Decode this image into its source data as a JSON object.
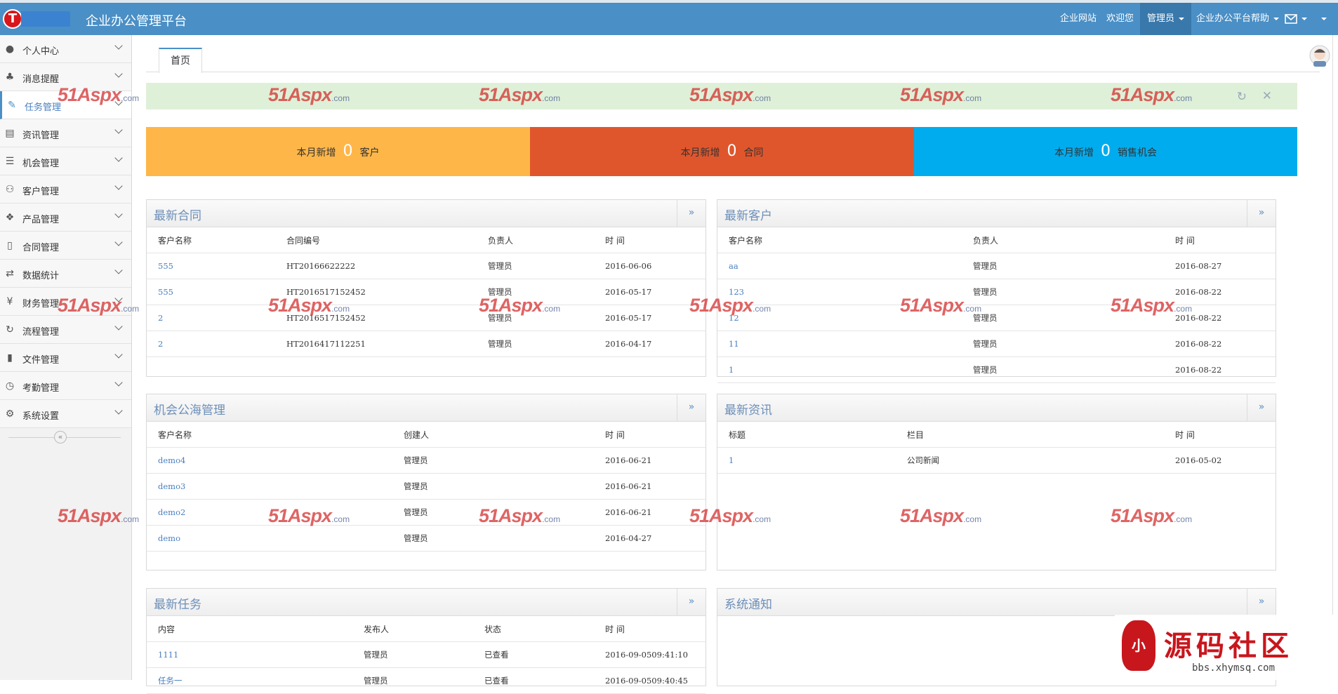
{
  "header": {
    "logo_letter": "T",
    "title": "企业办公管理平台",
    "nav": [
      {
        "label": "企业网站"
      },
      {
        "label": "欢迎您"
      },
      {
        "label": "管理员"
      },
      {
        "label": "企业办公平台帮助"
      }
    ],
    "mail_icon": "mail-icon"
  },
  "sidebar": {
    "items": [
      {
        "label": "个人中心",
        "icon": "user-icon"
      },
      {
        "label": "消息提醒",
        "icon": "bell-icon"
      },
      {
        "label": "任务管理",
        "icon": "edit-icon"
      },
      {
        "label": "资讯管理",
        "icon": "document-icon"
      },
      {
        "label": "机会管理",
        "icon": "list-icon"
      },
      {
        "label": "客户管理",
        "icon": "users-icon"
      },
      {
        "label": "产品管理",
        "icon": "dropbox-icon"
      },
      {
        "label": "合同管理",
        "icon": "folder-open-icon"
      },
      {
        "label": "数据统计",
        "icon": "random-icon"
      },
      {
        "label": "财务管理",
        "icon": "yen-icon"
      },
      {
        "label": "流程管理",
        "icon": "retweet-icon"
      },
      {
        "label": "文件管理",
        "icon": "file-icon"
      },
      {
        "label": "考勤管理",
        "icon": "clock-icon"
      },
      {
        "label": "系统设置",
        "icon": "gear-icon"
      }
    ],
    "collapse_glyph": "«"
  },
  "tabs": [
    {
      "label": "首页"
    }
  ],
  "stats": [
    {
      "prefix": "本月新增",
      "value": "0",
      "suffix": "客户",
      "color": "#ffb648"
    },
    {
      "prefix": "本月新增",
      "value": "0",
      "suffix": "合同",
      "color": "#e0562c"
    },
    {
      "prefix": "本月新增",
      "value": "0",
      "suffix": "销售机会",
      "color": "#00acee"
    }
  ],
  "panels": {
    "contracts": {
      "title": "最新合同",
      "more": "»",
      "columns": [
        "客户名称",
        "合同编号",
        "负责人",
        "时 间"
      ],
      "rows": [
        [
          "555",
          "HT20166622222",
          "管理员",
          "2016-06-06"
        ],
        [
          "555",
          "HT2016517152452",
          "管理员",
          "2016-05-17"
        ],
        [
          "2",
          "HT2016517152452",
          "管理员",
          "2016-05-17"
        ],
        [
          "2",
          "HT2016417112251",
          "管理员",
          "2016-04-17"
        ]
      ]
    },
    "customers": {
      "title": "最新客户",
      "more": "»",
      "columns": [
        "客户名称",
        "负责人",
        "时 间"
      ],
      "rows": [
        [
          "aa",
          "管理员",
          "2016-08-27"
        ],
        [
          "123",
          "管理员",
          "2016-08-22"
        ],
        [
          "12",
          "管理员",
          "2016-08-22"
        ],
        [
          "11",
          "管理员",
          "2016-08-22"
        ],
        [
          "1",
          "管理员",
          "2016-08-22"
        ]
      ]
    },
    "opportunities": {
      "title": "机会公海管理",
      "more": "»",
      "columns": [
        "客户名称",
        "创建人",
        "时 间"
      ],
      "rows": [
        [
          "demo4",
          "管理员",
          "2016-06-21"
        ],
        [
          "demo3",
          "管理员",
          "2016-06-21"
        ],
        [
          "demo2",
          "管理员",
          "2016-06-21"
        ],
        [
          "demo",
          "管理员",
          "2016-04-27"
        ]
      ]
    },
    "news": {
      "title": "最新资讯",
      "more": "»",
      "columns": [
        "标题",
        "栏目",
        "时 间"
      ],
      "rows": [
        [
          "1",
          "公司新闻",
          "2016-05-02"
        ]
      ]
    },
    "tasks": {
      "title": "最新任务",
      "more": "»",
      "columns": [
        "内容",
        "发布人",
        "状态",
        "时 间"
      ],
      "rows": [
        [
          "1111",
          "管理员",
          "已查看",
          "2016-09-0509:41:10"
        ],
        [
          "任务一",
          "管理员",
          "已查看",
          "2016-09-0509:40:45"
        ]
      ]
    },
    "notices": {
      "title": "系统通知",
      "more": "»"
    }
  },
  "watermark": {
    "text": "51Aspx",
    "suffix": ".com"
  },
  "footer_logo": {
    "mark": "小",
    "text": "源码社区",
    "url": "bbs.xhymsq.com"
  }
}
